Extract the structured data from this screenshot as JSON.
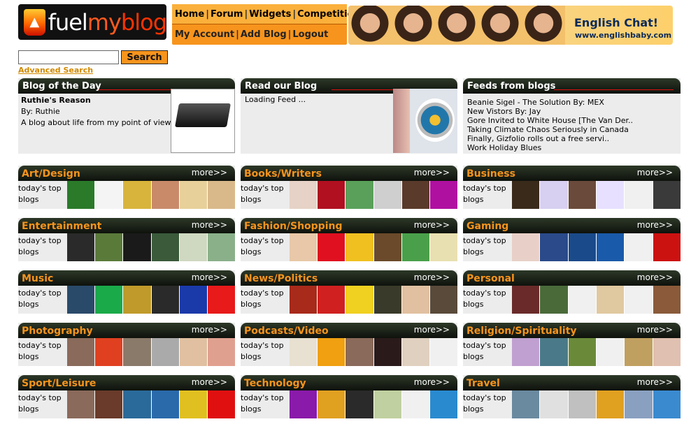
{
  "logo": {
    "fuel": "fuel",
    "my": "my",
    "blog": "blog"
  },
  "nav": {
    "top": [
      "Home",
      "Forum",
      "Widgets",
      "Competition"
    ],
    "bottom": [
      "My Account",
      "Add Blog",
      "Logout"
    ]
  },
  "ad": {
    "title": "English Chat!",
    "url": "www.englishbaby.com"
  },
  "search": {
    "value": "",
    "button": "Search",
    "advanced": "Advanced Search"
  },
  "blog_of_day": {
    "heading": "Blog of the Day",
    "title": "Ruthie's Reason",
    "author": "By: Ruthie",
    "description": "A blog about life from my point of view"
  },
  "read_blog": {
    "heading": "Read our Blog",
    "status": "Loading Feed ..."
  },
  "feeds": {
    "heading": "Feeds from blogs",
    "items": [
      "Beanie Sigel - The Solution By: MEX",
      "New Vistors By: Jay",
      "Gore Invited to White House [The Van Der..",
      "Taking Climate Chaos Seriously in Canada",
      "Finally, Gizfolio rolls out a free servi..",
      "Work Holiday Blues"
    ]
  },
  "category_common": {
    "more": "more>>",
    "top_line1": "today's top",
    "top_line2": "blogs"
  },
  "categories": [
    {
      "name": "Art/Design",
      "thumbs": [
        "#2a7a2a",
        "#f4f4f4",
        "#d8b43c",
        "#c98a6a",
        "#e8d09a",
        "#d9b98a"
      ]
    },
    {
      "name": "Books/Writers",
      "thumbs": [
        "#e6d2c6",
        "#b01020",
        "#5aa05a",
        "#cfcfcf",
        "#5a3a2a",
        "#b010a0"
      ]
    },
    {
      "name": "Business",
      "thumbs": [
        "#3a2a1a",
        "#d8d0f0",
        "#6a4a3a",
        "#e8e0ff",
        "#f0f0f0",
        "#3a3a3a"
      ]
    },
    {
      "name": "Entertainment",
      "thumbs": [
        "#2a2a2a",
        "#5a7a3a",
        "#1a1a1a",
        "#3a5a3a",
        "#cfd8c0",
        "#8ab08a"
      ]
    },
    {
      "name": "Fashion/Shopping",
      "thumbs": [
        "#e8c8a8",
        "#e01020",
        "#f0c020",
        "#6a4a2a",
        "#4aa04a",
        "#e8e0b0"
      ]
    },
    {
      "name": "Gaming",
      "thumbs": [
        "#e8d0c8",
        "#2a4a8a",
        "#1a4a8a",
        "#1a5aaa",
        "#f0f0f0",
        "#cc1111"
      ]
    },
    {
      "name": "Music",
      "thumbs": [
        "#2a4a6a",
        "#1aaa4a",
        "#c09a2a",
        "#2a2a2a",
        "#1a3aaa",
        "#e81a1a"
      ]
    },
    {
      "name": "News/Politics",
      "thumbs": [
        "#a82a1a",
        "#d02020",
        "#f0d020",
        "#3a3a2a",
        "#e0c0a0",
        "#5a4a3a"
      ]
    },
    {
      "name": "Personal",
      "thumbs": [
        "#6a2a2a",
        "#4a6a3a",
        "#f0f0f0",
        "#e0c8a0",
        "#f0f0f0",
        "#8a5a3a"
      ]
    },
    {
      "name": "Photography",
      "thumbs": [
        "#8a6a5a",
        "#e04020",
        "#8a7a6a",
        "#aaaaaa",
        "#e0c0a0",
        "#e0a090"
      ]
    },
    {
      "name": "Podcasts/Video",
      "thumbs": [
        "#e8e0d0",
        "#f0a010",
        "#8a6a5a",
        "#2a1a1a",
        "#e0d0c0",
        "#f0f0f0"
      ]
    },
    {
      "name": "Religion/Spirituality",
      "thumbs": [
        "#c0a0d0",
        "#4a7a8a",
        "#6a8a3a",
        "#f0f0f0",
        "#c0a060",
        "#e0c0b0"
      ]
    },
    {
      "name": "Sport/Leisure",
      "thumbs": [
        "#8a6a5a",
        "#6a3a2a",
        "#2a6a9a",
        "#2a6aaa",
        "#e0c020",
        "#e01010"
      ]
    },
    {
      "name": "Technology",
      "thumbs": [
        "#8a1aaa",
        "#e0a020",
        "#2a2a2a",
        "#c0d0a0",
        "#f0f0f0",
        "#2a8ad0"
      ]
    },
    {
      "name": "Travel",
      "thumbs": [
        "#6a8aa0",
        "#e0e0e0",
        "#c0c0c0",
        "#e0a020",
        "#8aa0c0",
        "#3a8ad0"
      ]
    }
  ]
}
